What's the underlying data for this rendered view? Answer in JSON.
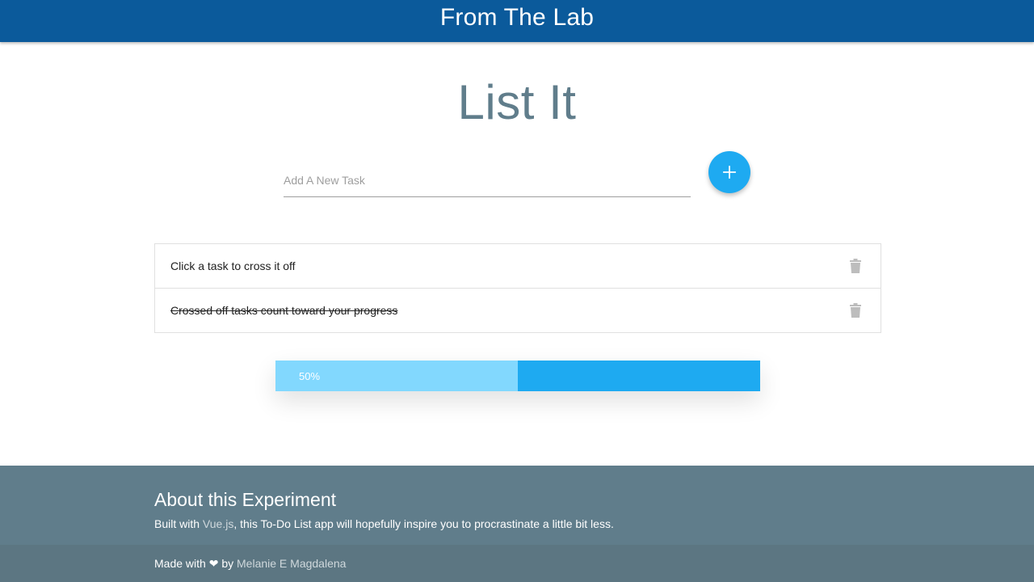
{
  "header": {
    "title": "From The Lab"
  },
  "app": {
    "title": "List It",
    "input": {
      "placeholder": "Add A New Task",
      "value": ""
    },
    "add_button_icon": "plus-icon"
  },
  "tasks": [
    {
      "text": "Click a task to cross it off",
      "done": false,
      "icon": "trash-icon"
    },
    {
      "text": "Crossed off tasks count toward your progress",
      "done": true,
      "icon": "trash-icon"
    }
  ],
  "progress": {
    "label": "50%",
    "value": 0.5
  },
  "footer": {
    "title": "About this Experiment",
    "text_before": "Built with ",
    "link": "Vue.js",
    "text_after": ", this To-Do List app will hopefully inspire you to procrastinate a little bit less.",
    "credit_before": "Made with ",
    "heart": "❤",
    "credit_middle": " by ",
    "credit_link": "Melanie E Magdalena"
  },
  "colors": {
    "header_bg": "#0b5a9b",
    "title": "#607d8b",
    "accent": "#1eaaf1",
    "progress_fill": "#82d8fe",
    "footer_bg": "#607d8b"
  }
}
